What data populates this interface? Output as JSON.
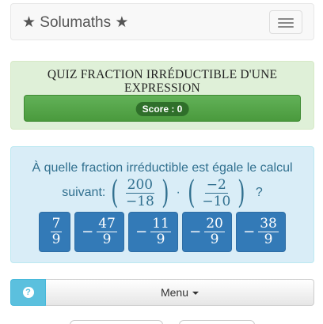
{
  "navbar": {
    "brand": "★ Solumaths ★",
    "toggle_icon": "hamburger-icon"
  },
  "quiz": {
    "title": "QUIZ FRACTION IRRÉDUCTIBLE D'UNE EXPRESSION",
    "score": "Score : 0"
  },
  "question": {
    "line1": "À quelle fraction irréductible est égale le calcul",
    "suivant": "suivant:",
    "frac1": {
      "num": "200",
      "den": "−18"
    },
    "operator": "·",
    "frac2": {
      "num": "−2",
      "den": "−10"
    },
    "qmark": "?"
  },
  "answers": [
    {
      "sign": "",
      "num": "7",
      "den": "9"
    },
    {
      "sign": "−",
      "num": "47",
      "den": "9"
    },
    {
      "sign": "−",
      "num": "11",
      "den": "9"
    },
    {
      "sign": "−",
      "num": "20",
      "den": "9"
    },
    {
      "sign": "−",
      "num": "38",
      "den": "9"
    }
  ],
  "footer": {
    "help_icon": "question-circle-icon",
    "help_glyph": "?",
    "menu_label": "Menu"
  },
  "colors": {
    "primary": "#337ab7",
    "success_bg": "#dff0d8",
    "info_bg": "#d9edf7",
    "help": "#5bc0de"
  }
}
